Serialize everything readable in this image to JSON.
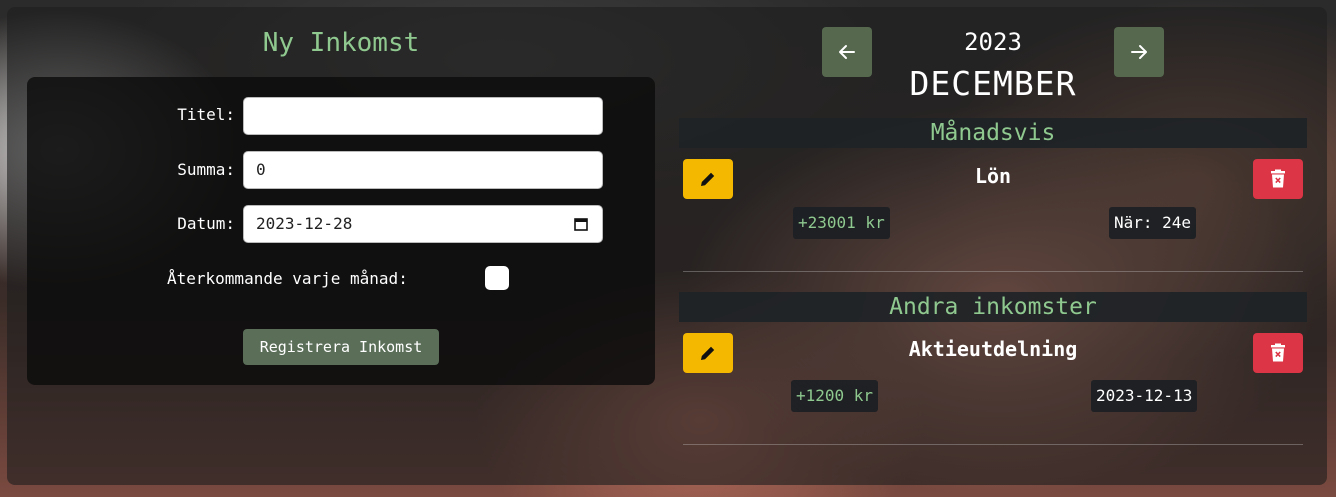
{
  "form": {
    "title": "Ny Inkomst",
    "title_label": "Titel:",
    "title_value": "",
    "sum_label": "Summa:",
    "sum_value": "0",
    "date_label": "Datum:",
    "date_value": "2023-12-28",
    "recurring_label": "Återkommande varje månad:",
    "recurring_checked": false,
    "submit_label": "Registrera Inkomst"
  },
  "nav": {
    "prev_icon": "arrow-left-icon",
    "next_icon": "arrow-right-icon",
    "year": "2023",
    "month": "DECEMBER"
  },
  "sections": [
    {
      "header": "Månadsvis",
      "items": [
        {
          "title": "Lön",
          "amount": "+23001 kr",
          "meta": "När: 24e"
        }
      ]
    },
    {
      "header": "Andra inkomster",
      "items": [
        {
          "title": "Aktieutdelning",
          "amount": "+1200 kr",
          "meta": "2023-12-13"
        }
      ]
    }
  ],
  "colors": {
    "accent_green": "#8fc98f",
    "button_green": "#5a6e58",
    "edit_yellow": "#f5b800",
    "delete_red": "#dc3545"
  }
}
